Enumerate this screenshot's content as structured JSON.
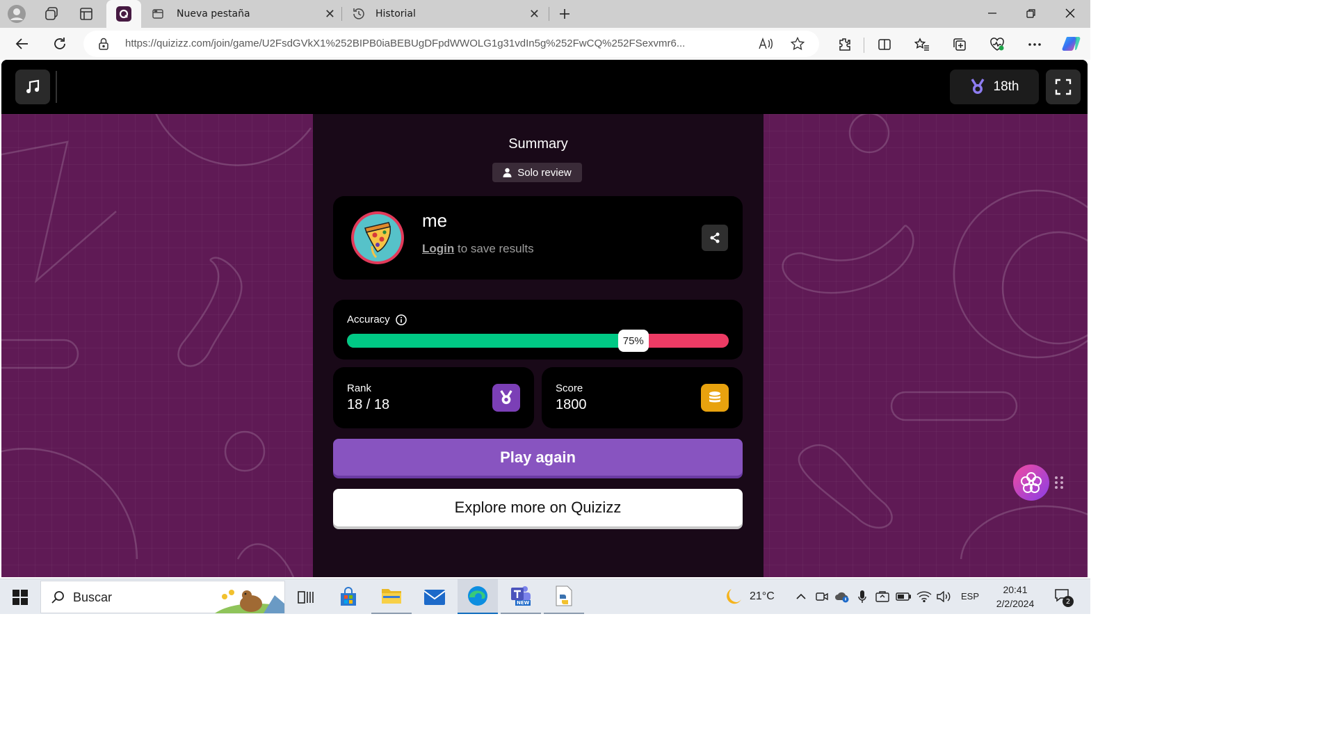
{
  "browser": {
    "tabs": [
      {
        "title": "",
        "icon": "quizizz-favicon",
        "active": true
      },
      {
        "title": "Nueva pestaña",
        "icon": "new-tab-icon",
        "active": false
      },
      {
        "title": "Historial",
        "icon": "history-icon",
        "active": false
      }
    ],
    "url": "https://quizizz.com/join/game/U2FsdGVkX1%252BIPB0iaBEBUgDFpdWWOLG1g31vdIn5g%252FwCQ%252FSexvmr6..."
  },
  "game": {
    "rank_badge": "18th",
    "summary_title": "Summary",
    "mode_label": "Solo review",
    "player": {
      "name": "me",
      "login_link": "Login",
      "login_suffix": " to save results"
    },
    "accuracy": {
      "label": "Accuracy",
      "value_text": "75%",
      "value": 0.75
    },
    "rank": {
      "label": "Rank",
      "value": "18 / 18"
    },
    "score": {
      "label": "Score",
      "value": "1800"
    },
    "play_again_label": "Play again",
    "explore_label": "Explore more on Quizizz"
  },
  "colors": {
    "purple_bg": "#5f1a55",
    "accent_purple": "#8854c0",
    "correct_green": "#00c985",
    "incorrect_red": "#ec3b64",
    "coin_orange": "#e8a20e"
  },
  "taskbar": {
    "search_placeholder": "Buscar",
    "weather": "21°C",
    "language": "ESP",
    "time": "20:41",
    "date": "2/2/2024",
    "notifications": "2",
    "teams_badge": "NEW"
  }
}
